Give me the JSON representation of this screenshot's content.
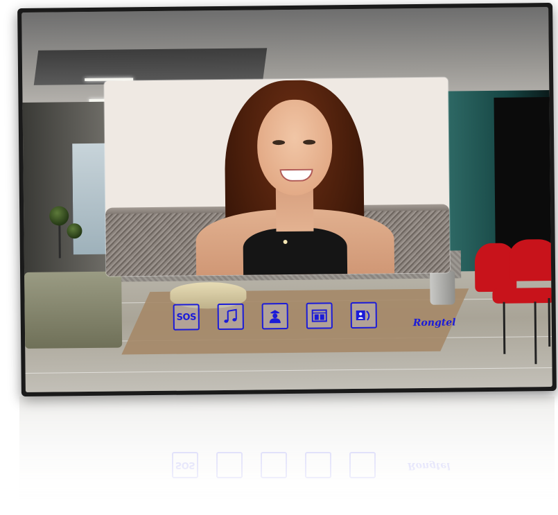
{
  "monitor": {
    "brand": "Rongtel",
    "accent_color": "#1b1bd8",
    "caller_video": {
      "description_icon": "caller-face"
    },
    "controls": [
      {
        "id": "sos",
        "label": "SOS",
        "icon": "sos-icon"
      },
      {
        "id": "music",
        "label": "",
        "icon": "music-note-icon"
      },
      {
        "id": "guard",
        "label": "",
        "icon": "security-guard-icon"
      },
      {
        "id": "unlock",
        "label": "",
        "icon": "door-gate-icon"
      },
      {
        "id": "intercom",
        "label": "",
        "icon": "intercom-call-icon"
      }
    ]
  }
}
